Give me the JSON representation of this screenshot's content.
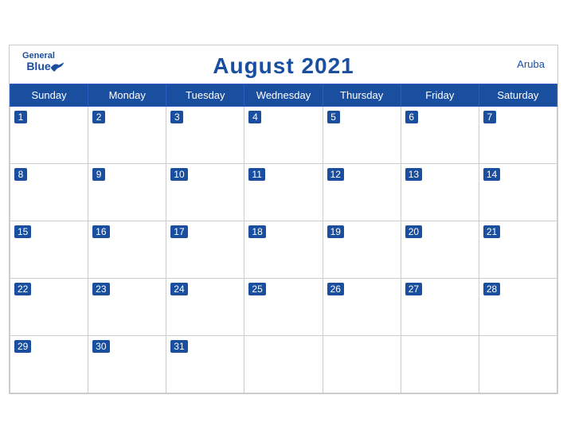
{
  "header": {
    "logo_general": "General",
    "logo_blue": "Blue",
    "title": "August 2021",
    "country": "Aruba"
  },
  "weekdays": [
    "Sunday",
    "Monday",
    "Tuesday",
    "Wednesday",
    "Thursday",
    "Friday",
    "Saturday"
  ],
  "weeks": [
    [
      1,
      2,
      3,
      4,
      5,
      6,
      7
    ],
    [
      8,
      9,
      10,
      11,
      12,
      13,
      14
    ],
    [
      15,
      16,
      17,
      18,
      19,
      20,
      21
    ],
    [
      22,
      23,
      24,
      25,
      26,
      27,
      28
    ],
    [
      29,
      30,
      31,
      null,
      null,
      null,
      null
    ]
  ]
}
